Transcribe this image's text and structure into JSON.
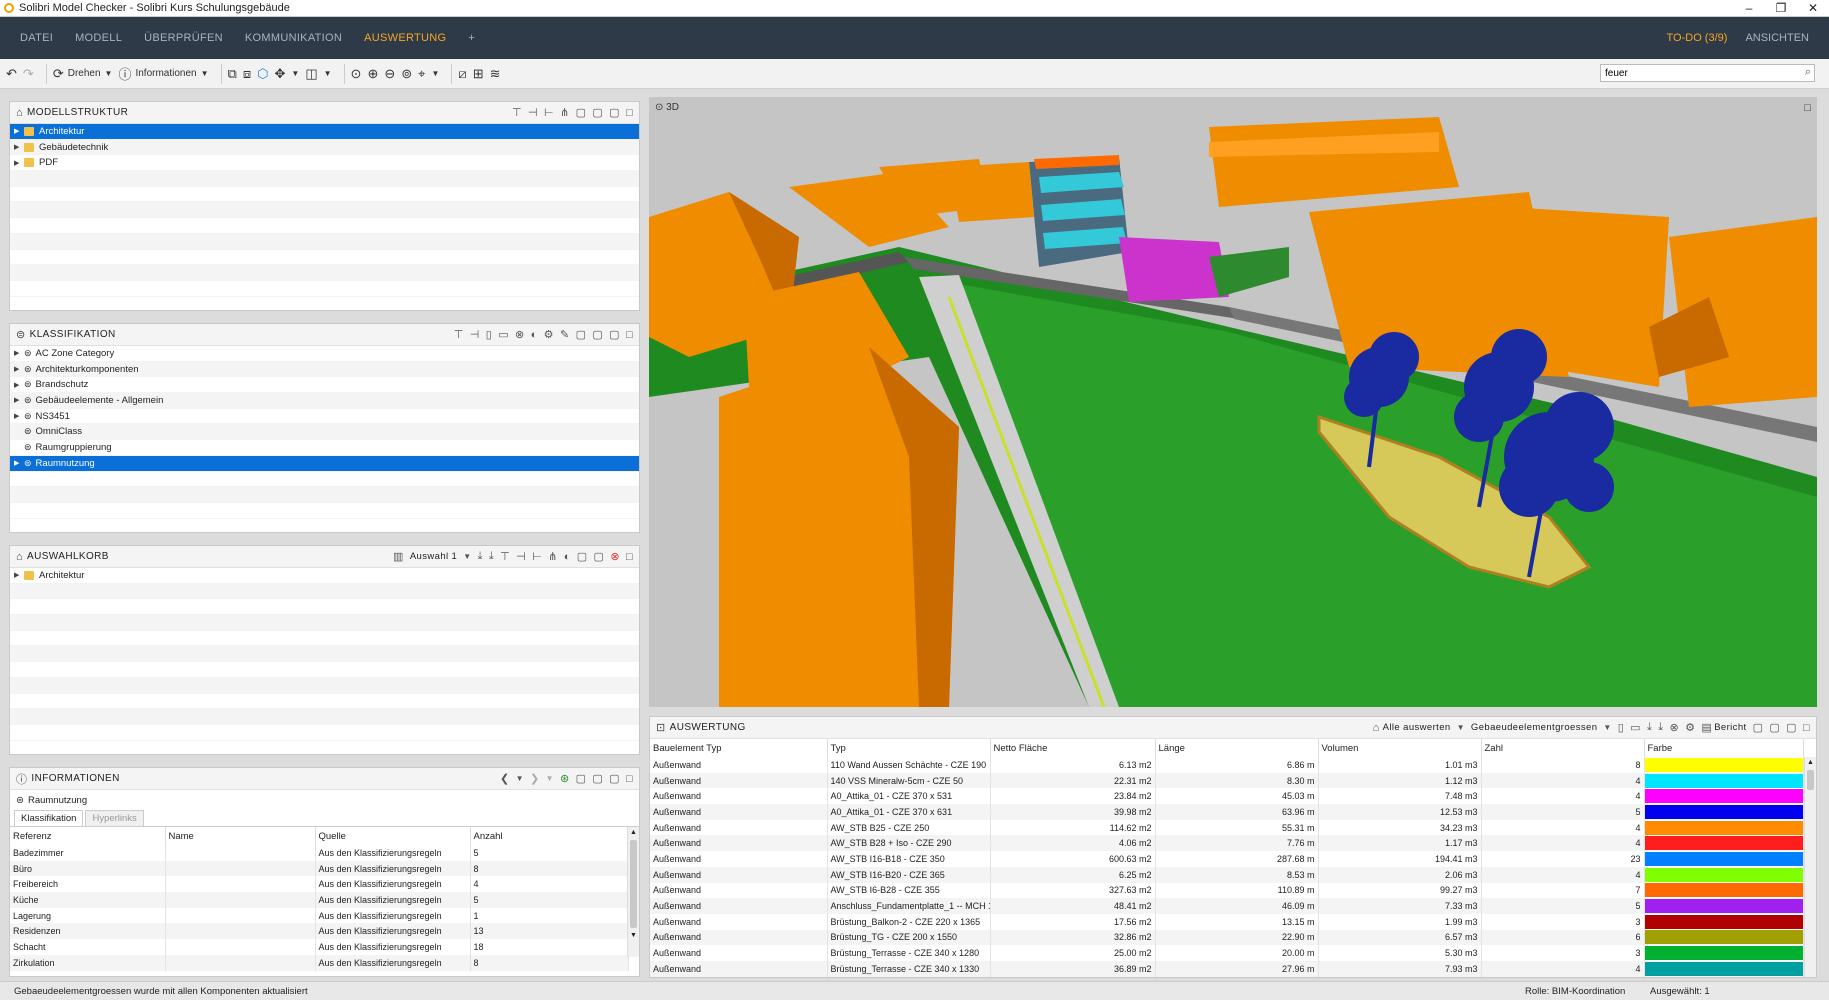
{
  "window": {
    "title": "Solibri Model Checker - Solibri Kurs Schulungsgebäude"
  },
  "menu": {
    "items": [
      "DATEI",
      "MODELL",
      "ÜBERPRÜFEN",
      "KOMMUNIKATION",
      "AUSWERTUNG",
      "+"
    ],
    "active_index": 4,
    "todo": "TO-DO (3/9)",
    "views": "ANSICHTEN"
  },
  "toolbar": {
    "rotate_label": "Drehen",
    "info_label": "Informationen",
    "search_value": "feuer"
  },
  "model_structure": {
    "title": "MODELLSTRUKTUR",
    "items": [
      {
        "label": "Architektur",
        "selected": true
      },
      {
        "label": "Gebäudetechnik",
        "selected": false
      },
      {
        "label": "PDF",
        "selected": false
      }
    ]
  },
  "classification": {
    "title": "KLASSIFIKATION",
    "items": [
      {
        "label": "AC Zone Category",
        "expandable": true,
        "selected": false
      },
      {
        "label": "Architekturkomponenten",
        "expandable": true,
        "selected": false
      },
      {
        "label": "Brandschutz",
        "expandable": true,
        "selected": false
      },
      {
        "label": "Gebäudeelemente - Allgemein",
        "expandable": true,
        "selected": false
      },
      {
        "label": "NS3451",
        "expandable": true,
        "selected": false
      },
      {
        "label": "OmniClass",
        "expandable": false,
        "selected": false
      },
      {
        "label": "Raumgruppierung",
        "expandable": false,
        "selected": false
      },
      {
        "label": "Raumnutzung",
        "expandable": true,
        "selected": true
      }
    ]
  },
  "selection_basket": {
    "title": "AUSWAHLKORB",
    "selection_label": "Auswahl 1",
    "items": [
      {
        "label": "Architektur"
      }
    ]
  },
  "info": {
    "title": "INFORMATIONEN",
    "subject": "Raumnutzung",
    "tabs": [
      "Klassifikation",
      "Hyperlinks"
    ],
    "columns": [
      "Referenz",
      "Name",
      "Quelle",
      "Anzahl"
    ],
    "rows": [
      [
        "Badezimmer",
        "",
        "Aus den Klassifizierungsregeln",
        "5"
      ],
      [
        "Büro",
        "",
        "Aus den Klassifizierungsregeln",
        "8"
      ],
      [
        "Freibereich",
        "",
        "Aus den Klassifizierungsregeln",
        "4"
      ],
      [
        "Küche",
        "",
        "Aus den Klassifizierungsregeln",
        "5"
      ],
      [
        "Lagerung",
        "",
        "Aus den Klassifizierungsregeln",
        "1"
      ],
      [
        "Residenzen",
        "",
        "Aus den Klassifizierungsregeln",
        "13"
      ],
      [
        "Schacht",
        "",
        "Aus den Klassifizierungsregeln",
        "18"
      ],
      [
        "Zirkulation",
        "",
        "Aus den Klassifizierungsregeln",
        "8"
      ]
    ]
  },
  "view3d": {
    "label": "3D"
  },
  "report": {
    "title": "AUSWERTUNG",
    "report_all": "Alle auswerten",
    "template": "Gebaeudeelementgroessen",
    "report_btn": "Bericht",
    "columns": [
      "Bauelement Typ",
      "Typ",
      "Netto Fläche",
      "Länge",
      "Volumen",
      "Zahl",
      "Farbe"
    ],
    "rows": [
      [
        "Außenwand",
        "110 Wand Aussen Schächte - CZE 190",
        "6.13 m2",
        "6.86 m",
        "1.01 m3",
        "8",
        "#ffff00"
      ],
      [
        "Außenwand",
        "140 VSS Mineralw-5cm - CZE 50",
        "22.31 m2",
        "8.30 m",
        "1.12 m3",
        "4",
        "#00e5ff"
      ],
      [
        "Außenwand",
        "A0_Attika_01 - CZE 370 x 531",
        "23.84 m2",
        "45.03 m",
        "7.48 m3",
        "4",
        "#ff00ff"
      ],
      [
        "Außenwand",
        "A0_Attika_01 - CZE 370 x 631",
        "39.98 m2",
        "63.96 m",
        "12.53 m3",
        "5",
        "#0000ee"
      ],
      [
        "Außenwand",
        "AW_STB B25 - CZE 250",
        "114.62 m2",
        "55.31 m",
        "34.23 m3",
        "4",
        "#ff8c00"
      ],
      [
        "Außenwand",
        "AW_STB B28 + Iso - CZE 290",
        "4.06 m2",
        "7.76 m",
        "1.17 m3",
        "4",
        "#ff1e1e"
      ],
      [
        "Außenwand",
        "AW_STB I16-B18 - CZE 350",
        "600.63 m2",
        "287.68 m",
        "194.41 m3",
        "23",
        "#0080ff"
      ],
      [
        "Außenwand",
        "AW_STB I16-B20 - CZE 365",
        "6.25 m2",
        "8.53 m",
        "2.06 m3",
        "4",
        "#80ff00"
      ],
      [
        "Außenwand",
        "AW_STB I6-B28 - CZE 355",
        "327.63 m2",
        "110.89 m",
        "99.27 m3",
        "7",
        "#ff6a00"
      ],
      [
        "Außenwand",
        "Anschluss_Fundamentplatte_1 -- MCH 1...",
        "48.41 m2",
        "46.09 m",
        "7.33 m3",
        "5",
        "#a020f0"
      ],
      [
        "Außenwand",
        "Brüstung_Balkon-2 - CZE 220 x 1365",
        "17.56 m2",
        "13.15 m",
        "1.99 m3",
        "3",
        "#b00000"
      ],
      [
        "Außenwand",
        "Brüstung_TG - CZE 200 x 1550",
        "32.86 m2",
        "22.90 m",
        "6.57 m3",
        "6",
        "#a0a000"
      ],
      [
        "Außenwand",
        "Brüstung_Terrasse - CZE 340 x 1280",
        "25.00 m2",
        "20.00 m",
        "5.30 m3",
        "3",
        "#00b030"
      ],
      [
        "Außenwand",
        "Brüstung_Terrasse - CZE 340 x 1330",
        "36.89 m2",
        "27.96 m",
        "7.93 m3",
        "4",
        "#00a0a0"
      ]
    ]
  },
  "status": {
    "message": "Gebaeudeelementgroessen wurde mit allen Komponenten aktualisiert",
    "role": "Rolle: BIM-Koordination",
    "selected": "Ausgewählt: 1"
  }
}
